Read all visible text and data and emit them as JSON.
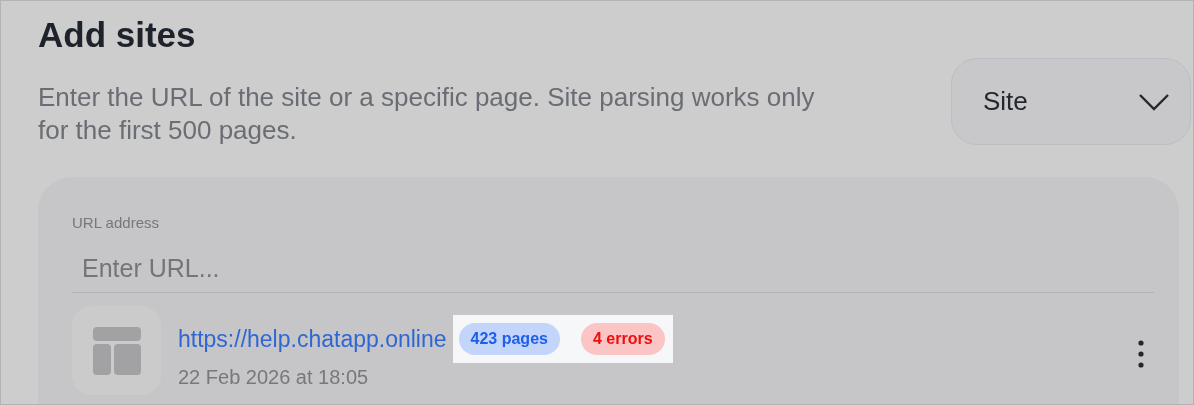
{
  "title": "Add sites",
  "description": "Enter the URL of the site or a specific page. Site parsing works only for the first 500 pages.",
  "type_select": {
    "value": "Site"
  },
  "url_field": {
    "label": "URL address",
    "placeholder": "Enter URL..."
  },
  "sites": [
    {
      "url": "https://help.chatapp.online",
      "date": "22 Feb 2026 at 18:05",
      "badges_highlighted": true,
      "badges": [
        {
          "kind": "pages",
          "text": "423 pages"
        },
        {
          "kind": "errors",
          "text": "4 errors"
        }
      ]
    }
  ]
}
